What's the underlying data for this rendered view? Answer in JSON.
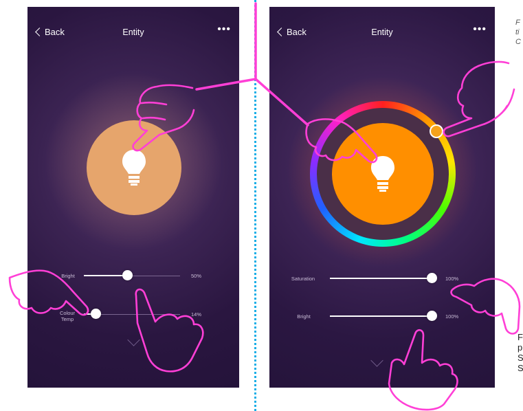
{
  "left_screen": {
    "back_label": "Back",
    "title": "Entity",
    "more_label": "•••",
    "bulb_color": "#e6a56c",
    "sliders": [
      {
        "label": "Bright",
        "value_text": "50%",
        "level": 0.45
      },
      {
        "label": "Colour Temp",
        "value_text": "14%",
        "level": 0.12
      }
    ]
  },
  "right_screen": {
    "back_label": "Back",
    "title": "Entity",
    "more_label": "•••",
    "bulb_color": "#ff8f00",
    "sliders": [
      {
        "label": "Saturation",
        "value_text": "100%",
        "level": 1.0
      },
      {
        "label": "Bright",
        "value_text": "100%",
        "level": 1.0
      }
    ]
  },
  "captions": {
    "top_right": [
      "F",
      "ti",
      "C"
    ],
    "bottom_right": [
      "F",
      "p",
      "S",
      "S"
    ]
  },
  "colors": {
    "annotation": "#ff3fd6",
    "divider": "#19aee6"
  }
}
